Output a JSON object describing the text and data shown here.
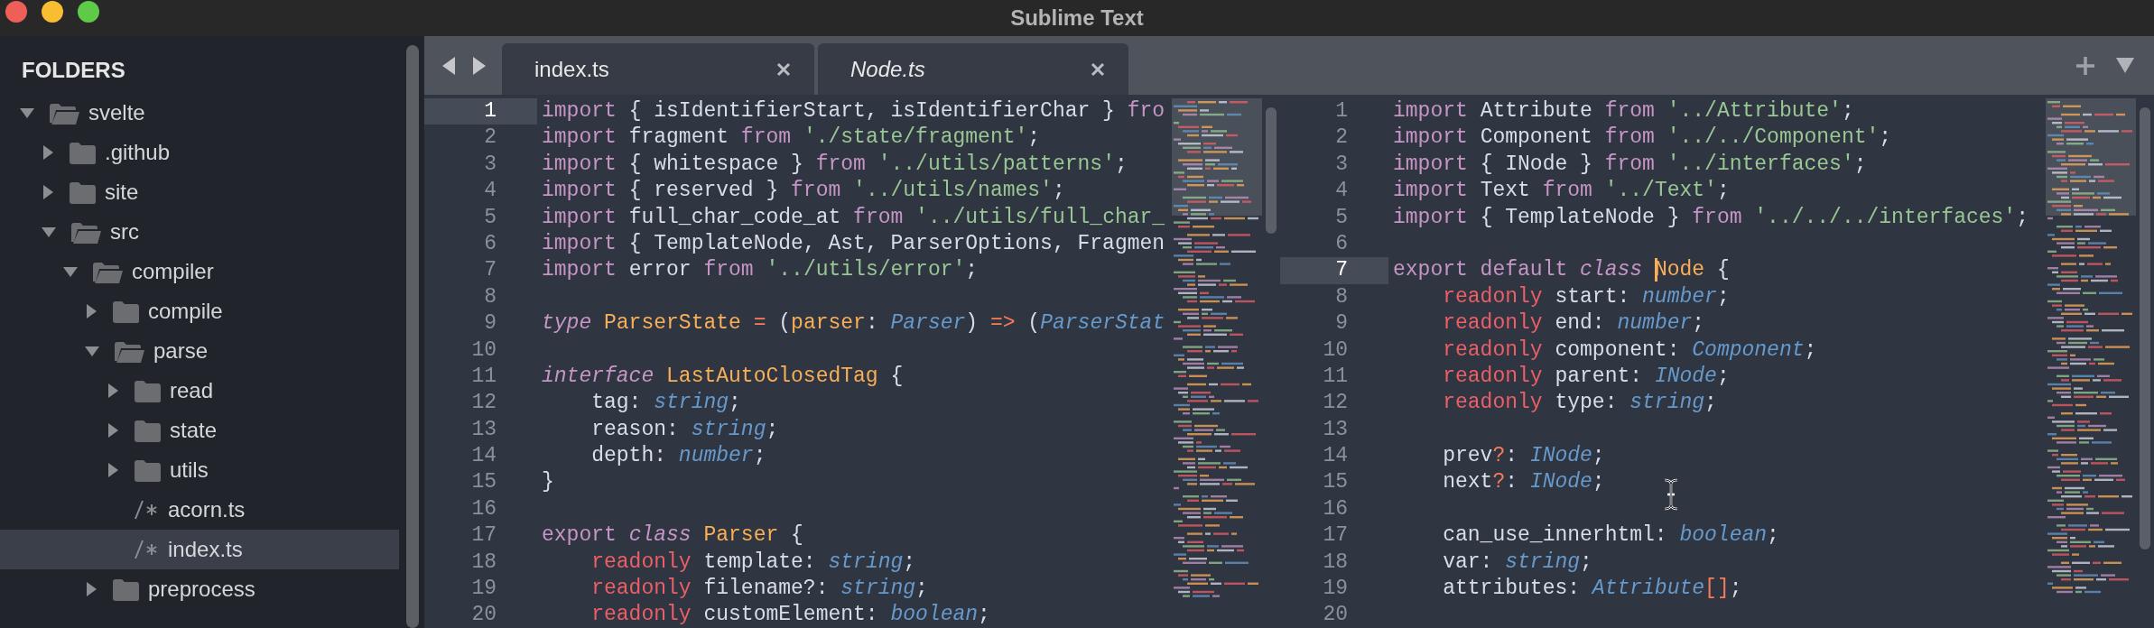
{
  "window": {
    "title": "Sublime Text"
  },
  "sidebar": {
    "heading": "FOLDERS",
    "tree": [
      {
        "label": "svelte",
        "kind": "folder",
        "expanded": true,
        "selected": false,
        "children": [
          {
            "label": ".github",
            "kind": "folder",
            "expanded": false,
            "selected": false
          },
          {
            "label": "site",
            "kind": "folder",
            "expanded": false,
            "selected": false
          },
          {
            "label": "src",
            "kind": "folder",
            "expanded": true,
            "selected": false,
            "children": [
              {
                "label": "compiler",
                "kind": "folder",
                "expanded": true,
                "selected": false,
                "children": [
                  {
                    "label": "compile",
                    "kind": "folder",
                    "expanded": false,
                    "selected": false
                  },
                  {
                    "label": "parse",
                    "kind": "folder",
                    "expanded": true,
                    "selected": false,
                    "children": [
                      {
                        "label": "read",
                        "kind": "folder",
                        "expanded": false,
                        "selected": false
                      },
                      {
                        "label": "state",
                        "kind": "folder",
                        "expanded": false,
                        "selected": false
                      },
                      {
                        "label": "utils",
                        "kind": "folder",
                        "expanded": false,
                        "selected": false
                      },
                      {
                        "label": "acorn.ts",
                        "kind": "file",
                        "selected": false
                      },
                      {
                        "label": "index.ts",
                        "kind": "file",
                        "selected": true
                      }
                    ]
                  },
                  {
                    "label": "preprocess",
                    "kind": "folder",
                    "expanded": false,
                    "selected": false
                  }
                ]
              }
            ]
          }
        ]
      }
    ]
  },
  "panes": [
    {
      "tab": {
        "label": "index.ts",
        "selected": true,
        "preview": false
      },
      "lines": [
        {
          "number": "1",
          "current": true,
          "tokens": [
            {
              "kind": "kw",
              "text": "import"
            },
            {
              "kind": "plain",
              "text": " { isIdentifierStart, isIdentifierChar } "
            },
            {
              "kind": "kw",
              "text": "fro"
            }
          ]
        },
        {
          "number": "2",
          "current": false,
          "tokens": [
            {
              "kind": "kw",
              "text": "import"
            },
            {
              "kind": "plain",
              "text": " fragment "
            },
            {
              "kind": "kw",
              "text": "from "
            },
            {
              "kind": "str",
              "text": "'./state/fragment'"
            },
            {
              "kind": "plain",
              "text": ";"
            }
          ]
        },
        {
          "number": "3",
          "current": false,
          "tokens": [
            {
              "kind": "kw",
              "text": "import"
            },
            {
              "kind": "plain",
              "text": " { whitespace } "
            },
            {
              "kind": "kw",
              "text": "from "
            },
            {
              "kind": "str",
              "text": "'../utils/patterns'"
            },
            {
              "kind": "plain",
              "text": ";"
            }
          ]
        },
        {
          "number": "4",
          "current": false,
          "tokens": [
            {
              "kind": "kw",
              "text": "import"
            },
            {
              "kind": "plain",
              "text": " { reserved } "
            },
            {
              "kind": "kw",
              "text": "from "
            },
            {
              "kind": "str",
              "text": "'../utils/names'"
            },
            {
              "kind": "plain",
              "text": ";"
            }
          ]
        },
        {
          "number": "5",
          "current": false,
          "tokens": [
            {
              "kind": "kw",
              "text": "import"
            },
            {
              "kind": "plain",
              "text": " full_char_code_at "
            },
            {
              "kind": "kw",
              "text": "from "
            },
            {
              "kind": "str",
              "text": "'../utils/full_char_"
            }
          ]
        },
        {
          "number": "6",
          "current": false,
          "tokens": [
            {
              "kind": "kw",
              "text": "import"
            },
            {
              "kind": "plain",
              "text": " { TemplateNode, Ast, ParserOptions, Fragmen"
            }
          ]
        },
        {
          "number": "7",
          "current": false,
          "tokens": [
            {
              "kind": "kw",
              "text": "import"
            },
            {
              "kind": "plain",
              "text": " error "
            },
            {
              "kind": "kw",
              "text": "from "
            },
            {
              "kind": "str",
              "text": "'../utils/error'"
            },
            {
              "kind": "plain",
              "text": ";"
            }
          ]
        },
        {
          "number": "8",
          "current": false
        },
        {
          "number": "9",
          "current": false,
          "tokens": [
            {
              "kind": "kwi",
              "text": "type "
            },
            {
              "kind": "cls",
              "text": "ParserState "
            },
            {
              "kind": "op",
              "text": "="
            },
            {
              "kind": "plain",
              "text": " ("
            },
            {
              "kind": "cls",
              "text": "parser"
            },
            {
              "kind": "plain",
              "text": ": "
            },
            {
              "kind": "typ",
              "text": "Parser"
            },
            {
              "kind": "plain",
              "text": ") "
            },
            {
              "kind": "op",
              "text": "=>"
            },
            {
              "kind": "plain",
              "text": " ("
            },
            {
              "kind": "typ",
              "text": "ParserStat"
            }
          ]
        },
        {
          "number": "10",
          "current": false
        },
        {
          "number": "11",
          "current": false,
          "tokens": [
            {
              "kind": "kwi",
              "text": "interface "
            },
            {
              "kind": "cls",
              "text": "LastAutoClosedTag"
            },
            {
              "kind": "plain",
              "text": " {"
            }
          ]
        },
        {
          "number": "12",
          "current": false,
          "tokens": [
            {
              "kind": "plain",
              "text": "    tag: "
            },
            {
              "kind": "typ",
              "text": "string"
            },
            {
              "kind": "plain",
              "text": ";"
            }
          ]
        },
        {
          "number": "13",
          "current": false,
          "tokens": [
            {
              "kind": "plain",
              "text": "    reason: "
            },
            {
              "kind": "typ",
              "text": "string"
            },
            {
              "kind": "plain",
              "text": ";"
            }
          ]
        },
        {
          "number": "14",
          "current": false,
          "tokens": [
            {
              "kind": "plain",
              "text": "    depth: "
            },
            {
              "kind": "typ",
              "text": "number"
            },
            {
              "kind": "plain",
              "text": ";"
            }
          ]
        },
        {
          "number": "15",
          "current": false,
          "tokens": [
            {
              "kind": "plain",
              "text": "}"
            }
          ]
        },
        {
          "number": "16",
          "current": false
        },
        {
          "number": "17",
          "current": false,
          "tokens": [
            {
              "kind": "kw",
              "text": "export "
            },
            {
              "kind": "kwi",
              "text": "class "
            },
            {
              "kind": "cls",
              "text": "Parser"
            },
            {
              "kind": "plain",
              "text": " {"
            }
          ]
        },
        {
          "number": "18",
          "current": false,
          "tokens": [
            {
              "kind": "mod",
              "text": "    readonly"
            },
            {
              "kind": "plain",
              "text": " template: "
            },
            {
              "kind": "typ",
              "text": "string"
            },
            {
              "kind": "plain",
              "text": ";"
            }
          ]
        },
        {
          "number": "19",
          "current": false,
          "tokens": [
            {
              "kind": "mod",
              "text": "    readonly"
            },
            {
              "kind": "plain",
              "text": " filename?: "
            },
            {
              "kind": "typ",
              "text": "string"
            },
            {
              "kind": "plain",
              "text": ";"
            }
          ]
        },
        {
          "number": "20",
          "current": false,
          "tokens": [
            {
              "kind": "mod",
              "text": "    readonly"
            },
            {
              "kind": "plain",
              "text": " customElement: "
            },
            {
              "kind": "typ",
              "text": "boolean"
            },
            {
              "kind": "plain",
              "text": ";"
            }
          ]
        }
      ]
    },
    {
      "tab": {
        "label": "Node.ts",
        "selected": true,
        "preview": true
      },
      "lines": [
        {
          "number": "1",
          "current": false,
          "tokens": [
            {
              "kind": "kw",
              "text": "import"
            },
            {
              "kind": "plain",
              "text": " Attribute "
            },
            {
              "kind": "kw",
              "text": "from "
            },
            {
              "kind": "str",
              "text": "'../Attribute'"
            },
            {
              "kind": "plain",
              "text": ";"
            }
          ]
        },
        {
          "number": "2",
          "current": false,
          "tokens": [
            {
              "kind": "kw",
              "text": "import"
            },
            {
              "kind": "plain",
              "text": " Component "
            },
            {
              "kind": "kw",
              "text": "from "
            },
            {
              "kind": "str",
              "text": "'../../Component'"
            },
            {
              "kind": "plain",
              "text": ";"
            }
          ]
        },
        {
          "number": "3",
          "current": false,
          "tokens": [
            {
              "kind": "kw",
              "text": "import"
            },
            {
              "kind": "plain",
              "text": " { INode } "
            },
            {
              "kind": "kw",
              "text": "from "
            },
            {
              "kind": "str",
              "text": "'../interfaces'"
            },
            {
              "kind": "plain",
              "text": ";"
            }
          ]
        },
        {
          "number": "4",
          "current": false,
          "tokens": [
            {
              "kind": "kw",
              "text": "import"
            },
            {
              "kind": "plain",
              "text": " Text "
            },
            {
              "kind": "kw",
              "text": "from "
            },
            {
              "kind": "str",
              "text": "'../Text'"
            },
            {
              "kind": "plain",
              "text": ";"
            }
          ]
        },
        {
          "number": "5",
          "current": false,
          "tokens": [
            {
              "kind": "kw",
              "text": "import"
            },
            {
              "kind": "plain",
              "text": " { TemplateNode } "
            },
            {
              "kind": "kw",
              "text": "from "
            },
            {
              "kind": "str",
              "text": "'../../../interfaces'"
            },
            {
              "kind": "plain",
              "text": ";"
            }
          ]
        },
        {
          "number": "6",
          "current": false
        },
        {
          "number": "7",
          "current": true,
          "tokens": [
            {
              "kind": "kw",
              "text": "export default "
            },
            {
              "kind": "kwi",
              "text": "class "
            },
            {
              "kind": "caret"
            },
            {
              "kind": "cls",
              "text": "Node"
            },
            {
              "kind": "plain",
              "text": " {"
            }
          ]
        },
        {
          "number": "8",
          "current": false,
          "tokens": [
            {
              "kind": "mod",
              "text": "    readonly"
            },
            {
              "kind": "plain",
              "text": " start: "
            },
            {
              "kind": "typ",
              "text": "number"
            },
            {
              "kind": "plain",
              "text": ";"
            }
          ]
        },
        {
          "number": "9",
          "current": false,
          "tokens": [
            {
              "kind": "mod",
              "text": "    readonly"
            },
            {
              "kind": "plain",
              "text": " end: "
            },
            {
              "kind": "typ",
              "text": "number"
            },
            {
              "kind": "plain",
              "text": ";"
            }
          ]
        },
        {
          "number": "10",
          "current": false,
          "tokens": [
            {
              "kind": "mod",
              "text": "    readonly"
            },
            {
              "kind": "plain",
              "text": " component: "
            },
            {
              "kind": "typ",
              "text": "Component"
            },
            {
              "kind": "plain",
              "text": ";"
            }
          ]
        },
        {
          "number": "11",
          "current": false,
          "tokens": [
            {
              "kind": "mod",
              "text": "    readonly"
            },
            {
              "kind": "plain",
              "text": " parent: "
            },
            {
              "kind": "typ",
              "text": "INode"
            },
            {
              "kind": "plain",
              "text": ";"
            }
          ]
        },
        {
          "number": "12",
          "current": false,
          "tokens": [
            {
              "kind": "mod",
              "text": "    readonly"
            },
            {
              "kind": "plain",
              "text": " type: "
            },
            {
              "kind": "typ",
              "text": "string"
            },
            {
              "kind": "plain",
              "text": ";"
            }
          ]
        },
        {
          "number": "13",
          "current": false
        },
        {
          "number": "14",
          "current": false,
          "tokens": [
            {
              "kind": "plain",
              "text": "    prev"
            },
            {
              "kind": "op",
              "text": "?"
            },
            {
              "kind": "plain",
              "text": ": "
            },
            {
              "kind": "typ",
              "text": "INode"
            },
            {
              "kind": "plain",
              "text": ";"
            }
          ]
        },
        {
          "number": "15",
          "current": false,
          "tokens": [
            {
              "kind": "plain",
              "text": "    next"
            },
            {
              "kind": "op",
              "text": "?"
            },
            {
              "kind": "plain",
              "text": ": "
            },
            {
              "kind": "typ",
              "text": "INode"
            },
            {
              "kind": "plain",
              "text": ";"
            }
          ]
        },
        {
          "number": "16",
          "current": false
        },
        {
          "number": "17",
          "current": false,
          "tokens": [
            {
              "kind": "plain",
              "text": "    can_use_innerhtml: "
            },
            {
              "kind": "typ",
              "text": "boolean"
            },
            {
              "kind": "plain",
              "text": ";"
            }
          ]
        },
        {
          "number": "18",
          "current": false,
          "tokens": [
            {
              "kind": "plain",
              "text": "    var: "
            },
            {
              "kind": "typ",
              "text": "string"
            },
            {
              "kind": "plain",
              "text": ";"
            }
          ]
        },
        {
          "number": "19",
          "current": false,
          "tokens": [
            {
              "kind": "plain",
              "text": "    attributes: "
            },
            {
              "kind": "typ",
              "text": "Attribute"
            },
            {
              "kind": "op",
              "text": "[]"
            },
            {
              "kind": "plain",
              "text": ";"
            }
          ]
        },
        {
          "number": "20",
          "current": false
        }
      ]
    }
  ]
}
